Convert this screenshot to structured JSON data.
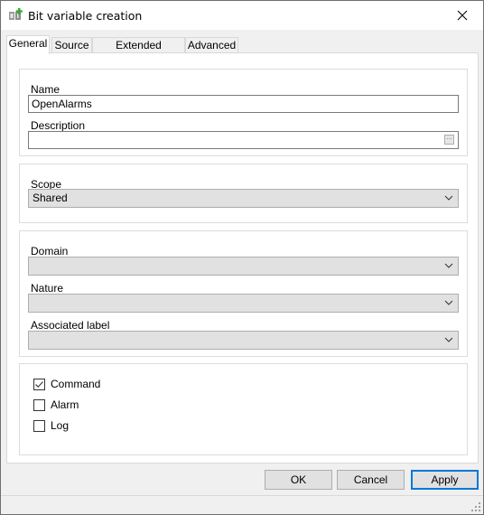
{
  "window": {
    "title": "Bit variable creation",
    "icon": "bit-variable-add-icon",
    "close_icon": "close-icon"
  },
  "tabs": [
    {
      "label": "General",
      "active": true
    },
    {
      "label": "Source",
      "active": false
    },
    {
      "label": "Extended attributes",
      "active": false
    },
    {
      "label": "Advanced",
      "active": false
    }
  ],
  "general": {
    "name": {
      "label": "Name",
      "value": "OpenAlarms"
    },
    "description": {
      "label": "Description",
      "value": "",
      "button_label": "..."
    },
    "scope": {
      "label": "Scope",
      "value": "Shared"
    },
    "domain": {
      "label": "Domain",
      "value": ""
    },
    "nature": {
      "label": "Nature",
      "value": ""
    },
    "associated_label": {
      "label": "Associated label",
      "value": ""
    },
    "checkboxes": [
      {
        "label": "Command",
        "checked": true
      },
      {
        "label": "Alarm",
        "checked": false
      },
      {
        "label": "Log",
        "checked": false
      }
    ]
  },
  "buttons": {
    "ok": "OK",
    "cancel": "Cancel",
    "apply": "Apply"
  },
  "colors": {
    "accent": "#0078d7",
    "dialog_bg": "#f0f0f0",
    "combo_bg": "#e1e1e1"
  }
}
